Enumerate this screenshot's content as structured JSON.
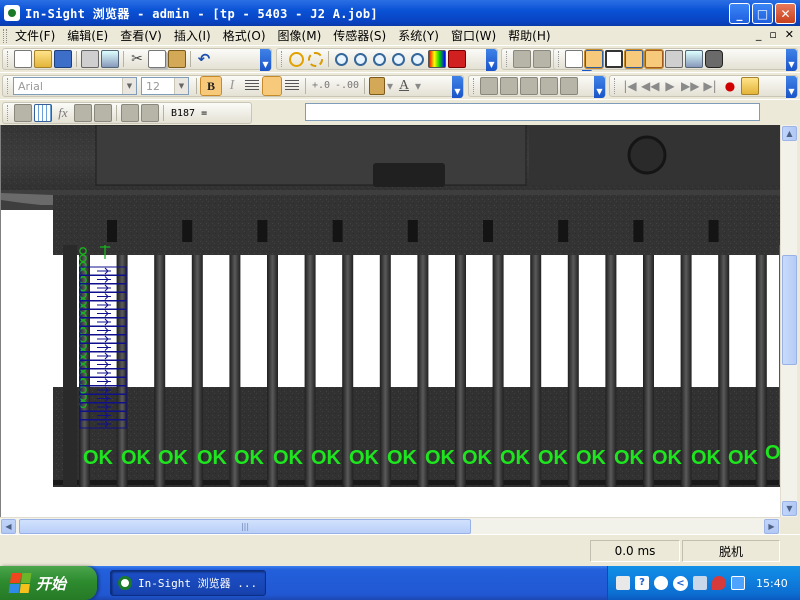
{
  "window": {
    "title": "In-Sight 浏览器 - admin - [tp - 5403 - J2 A.job]",
    "controls": {
      "minimize": "_",
      "maximize": "□",
      "close": "✕"
    }
  },
  "menu": {
    "items": [
      {
        "label": "文件(F)"
      },
      {
        "label": "编辑(E)"
      },
      {
        "label": "查看(V)"
      },
      {
        "label": "插入(I)"
      },
      {
        "label": "格式(O)"
      },
      {
        "label": "图像(M)"
      },
      {
        "label": "传感器(S)"
      },
      {
        "label": "系统(Y)"
      },
      {
        "label": "窗口(W)"
      },
      {
        "label": "帮助(H)"
      }
    ],
    "mdi": {
      "minimize": "_",
      "restore": "▫",
      "close": "✕"
    }
  },
  "format_toolbar": {
    "font_name": "Arial",
    "font_size": "12",
    "bold": "B",
    "italic": "I",
    "decimal_increase": "+.0",
    "decimal_decrease": "-.00",
    "font_color_glyph": "A"
  },
  "formula_bar": {
    "cell_ref": "B187 =",
    "value": "",
    "fx": "fx"
  },
  "inspection": {
    "pass_label": "OK",
    "pass_color": "#1ee61e",
    "tool_color_green": "#19b41e",
    "tool_color_blue": "#10108c",
    "result_count_full": 18,
    "result_partial": "O"
  },
  "scrollbars": {
    "up": "▲",
    "down": "▼",
    "left": "◀",
    "right": "▶",
    "thumb_grip": "|||"
  },
  "status": {
    "timing": "0.0 ms",
    "mode": "脱机"
  },
  "taskbar": {
    "start_label": "开始",
    "task_label": "In-Sight 浏览器 ...",
    "clock": "15:40",
    "tray_chevron": "<"
  },
  "colors": {
    "titlebar": "#0a52d6",
    "taskbar": "#2157d2",
    "start_button": "#2e8b2e",
    "tray": "#0c6fd2"
  }
}
